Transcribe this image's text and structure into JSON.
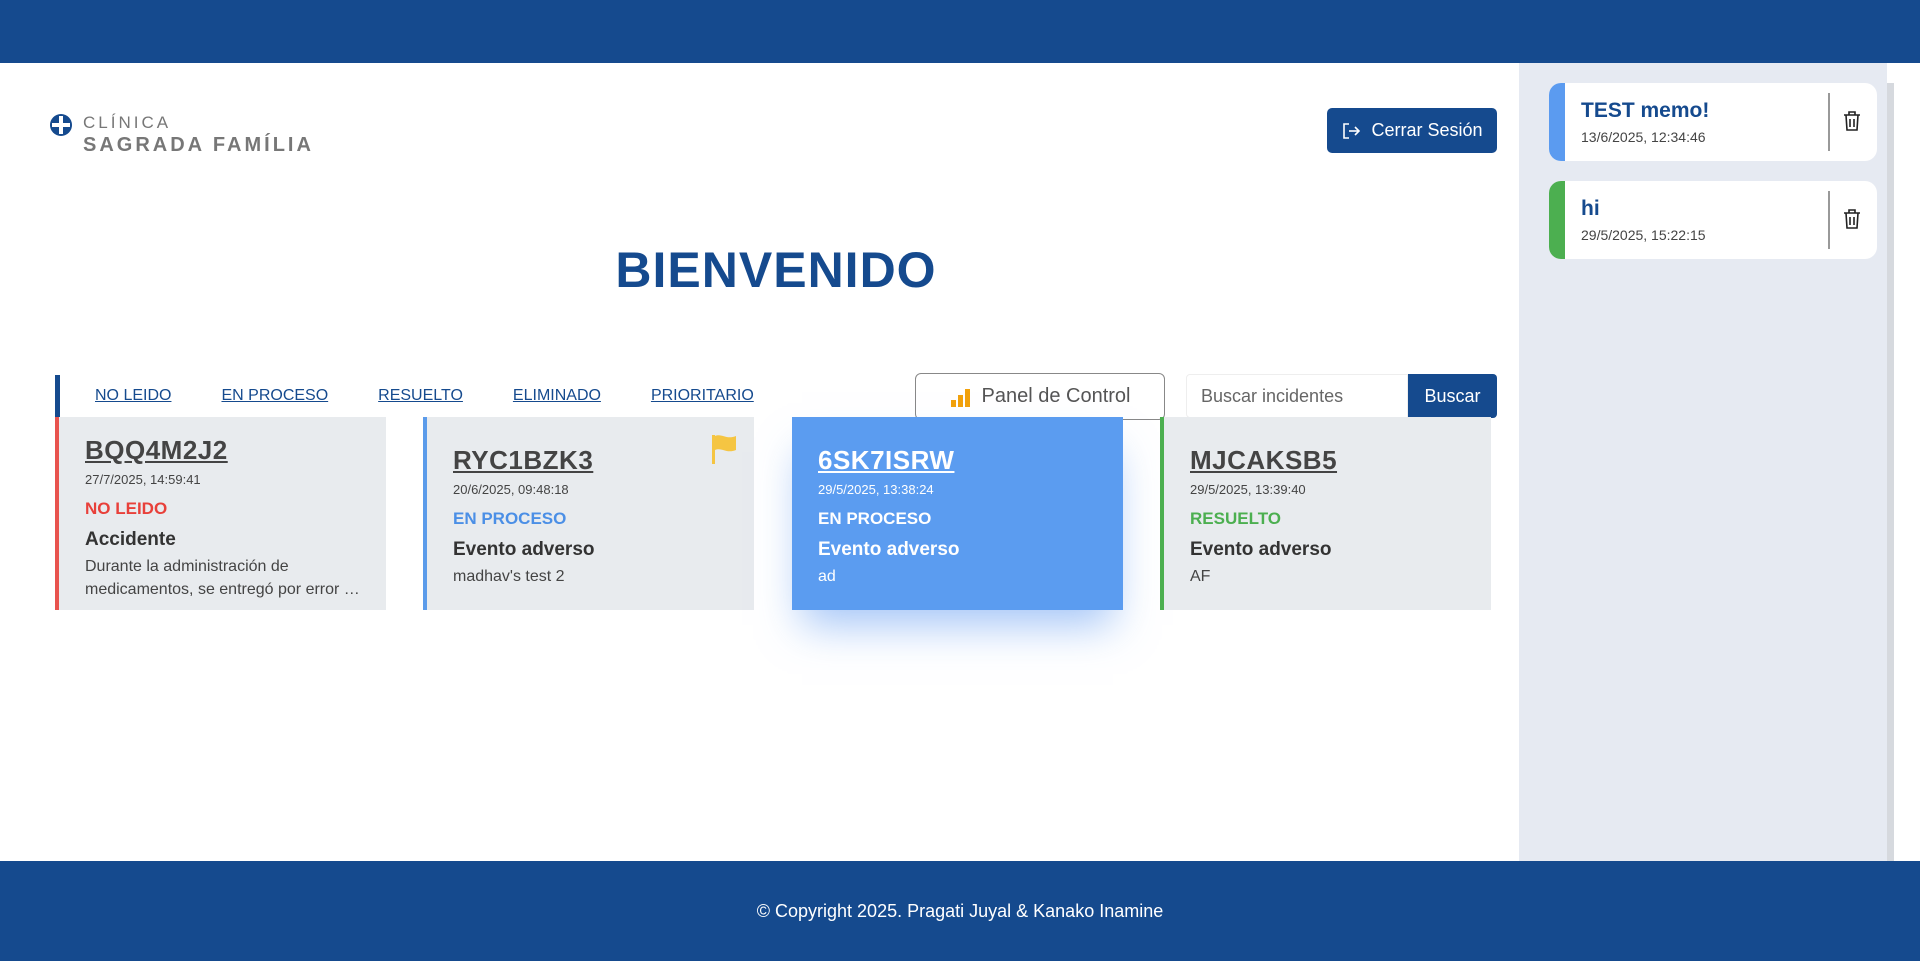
{
  "logo": {
    "line1": "CLÍNICA",
    "line2": "SAGRADA FAMÍLIA"
  },
  "header": {
    "logout_label": "Cerrar Sesión",
    "welcome": "BIENVENIDO"
  },
  "filters": [
    "NO LEIDO",
    "EN PROCESO",
    "RESUELTO",
    "ELIMINADO",
    "PRIORITARIO"
  ],
  "toolbar": {
    "panel_label": "Panel de Control",
    "search_placeholder": "Buscar incidentes",
    "search_button": "Buscar"
  },
  "cards": [
    {
      "code": "BQQ4M2J2",
      "date": "27/7/2025, 14:59:41",
      "status": "NO LEIDO",
      "type": "Accidente",
      "description": "Durante la administración de medicamentos, se entregó por error a un paciente",
      "accent": "#e8534e"
    },
    {
      "code": "RYC1BZK3",
      "date": "20/6/2025, 09:48:18",
      "status": "EN PROCESO",
      "type": "Evento adverso",
      "description": "madhav's test 2",
      "accent": "#5b9bea",
      "flagged": true
    },
    {
      "code": "6SK7ISRW",
      "date": "29/5/2025, 13:38:24",
      "status": "EN PROCESO",
      "type": "Evento adverso",
      "description": "ad",
      "accent": "#5b9cf0",
      "selected": true
    },
    {
      "code": "MJCAKSB5",
      "date": "29/5/2025, 13:39:40",
      "status": "RESUELTO",
      "type": "Evento adverso",
      "description": "AF",
      "accent": "#4caf50"
    }
  ],
  "memos": [
    {
      "title": "TEST memo!",
      "date": "13/6/2025, 12:34:46",
      "color": "#5b9bf0"
    },
    {
      "title": "hi",
      "date": "29/5/2025, 15:22:15",
      "color": "#4caf50"
    }
  ],
  "footer": {
    "copyright": "© Copyright 2025. Pragati Juyal & Kanako Inamine"
  },
  "colors": {
    "primary": "#154a8e",
    "sidebar": "#e6eaf2",
    "card": "#e8ebee",
    "flag": "#f5c542",
    "chart_icon": "#f2a20c"
  }
}
